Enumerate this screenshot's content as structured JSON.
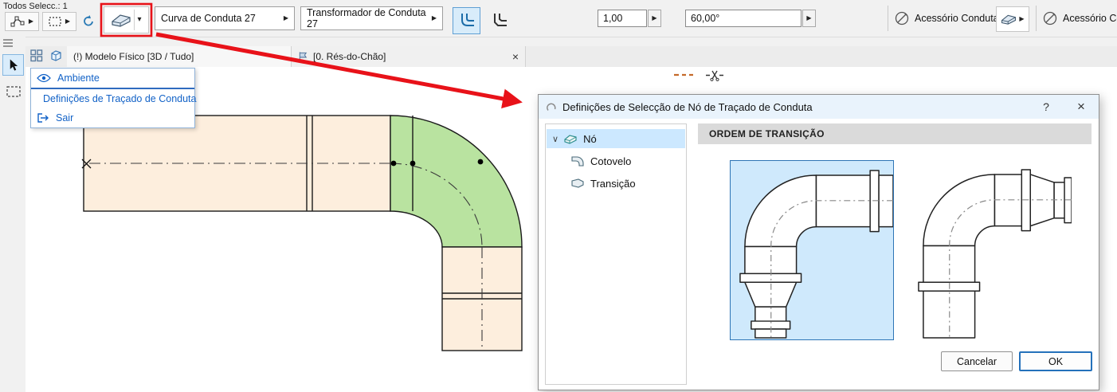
{
  "toolbar": {
    "status": "Todos Selecc.: 1",
    "curve_selector": "Curva de Conduta 27",
    "transformer_selector": "Transformador de Conduta 27",
    "ratio_value": "1,00",
    "angle_value": "60,00°",
    "accessory_duct": "Acessório Conduta",
    "accessory_duct_2": "Acessório Con"
  },
  "icons": {
    "flyout_arrow": "▶",
    "caret_down": "▾",
    "tree_chevron": "∨"
  },
  "tabs": {
    "model_tab": "(!) Modelo Físico [3D / Tudo]",
    "floor_tab": "[0. Rés-do-Chão]",
    "close_glyph": "×"
  },
  "context_menu": {
    "items": [
      {
        "label": "Ambiente"
      },
      {
        "label": "Definições de Traçado de Conduta"
      },
      {
        "label": "Sair"
      }
    ]
  },
  "dialog": {
    "title": "Definições de Selecção de Nó de Traçado de Conduta",
    "help_glyph": "?",
    "close_glyph": "×",
    "tree": {
      "root": "Nó",
      "children": [
        "Cotovelo",
        "Transição"
      ]
    },
    "section_title": "ORDEM DE TRANSIÇÃO",
    "cancel_label": "Cancelar",
    "ok_label": "OK"
  },
  "colors": {
    "duct_fill": "#fdeedd",
    "elbow_fill": "#b9e3a0",
    "selection_blue": "#cce8ff",
    "annotation_red": "#e81219",
    "preview_selected_bg": "#cfe9fc",
    "menu_link_blue": "#1262c7"
  }
}
